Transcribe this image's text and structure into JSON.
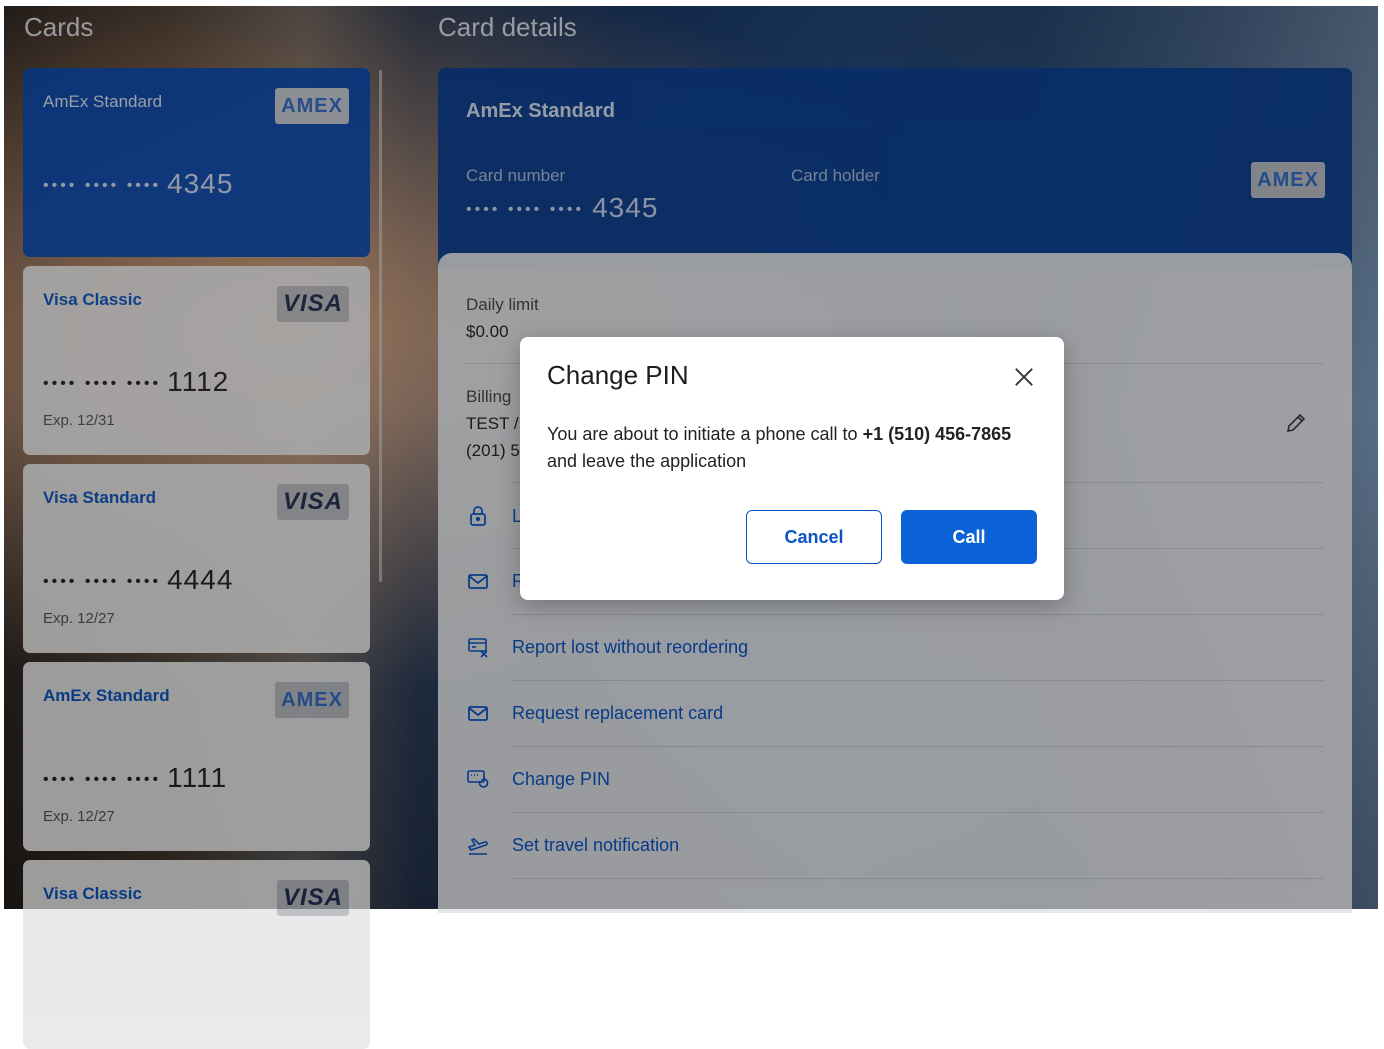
{
  "cards_panel": {
    "title": "Cards",
    "cards": [
      {
        "name": "AmEx Standard",
        "masked": "•••• •••• ••••",
        "last4": "4345",
        "expiry": "",
        "brand": "AMEX",
        "selected": true
      },
      {
        "name": "Visa Classic",
        "masked": "•••• •••• ••••",
        "last4": "1112",
        "expiry": "Exp. 12/31",
        "brand": "VISA",
        "selected": false
      },
      {
        "name": "Visa Standard",
        "masked": "•••• •••• ••••",
        "last4": "4444",
        "expiry": "Exp. 12/27",
        "brand": "VISA",
        "selected": false
      },
      {
        "name": "AmEx Standard",
        "masked": "•••• •••• ••••",
        "last4": "1111",
        "expiry": "Exp. 12/27",
        "brand": "AMEX",
        "selected": false
      },
      {
        "name": "Visa Classic",
        "masked": "",
        "last4": "",
        "expiry": "",
        "brand": "VISA",
        "selected": false
      }
    ]
  },
  "details_panel": {
    "title": "Card details",
    "card_name": "AmEx Standard",
    "card_number_label": "Card number",
    "card_number_masked": "•••• •••• ••••",
    "card_number_last4": "4345",
    "card_holder_label": "Card holder",
    "brand": "AMEX",
    "daily_limit_label": "Daily limit",
    "daily_limit_value": "$0.00",
    "billing_label": "Billing",
    "billing_line1": "TEST /",
    "billing_line2": "(201) 5",
    "actions": [
      {
        "label": "L",
        "icon": "lock-icon"
      },
      {
        "label": "R",
        "icon": "mail-icon"
      },
      {
        "label": "Report lost without reordering",
        "icon": "card-x-icon"
      },
      {
        "label": "Request replacement card",
        "icon": "mail-icon"
      },
      {
        "label": "Change PIN",
        "icon": "pin-refresh-icon"
      },
      {
        "label": "Set travel notification",
        "icon": "plane-icon"
      }
    ]
  },
  "modal": {
    "title": "Change PIN",
    "message_prefix": "You are about to initiate a phone call to ",
    "phone": "+1 (510) 456-7865",
    "message_suffix": "and leave the application",
    "cancel_label": "Cancel",
    "call_label": "Call"
  },
  "colors": {
    "primary": "#0b62d6",
    "card_blue": "#0c4bb0",
    "link_blue": "#0a55c4"
  }
}
